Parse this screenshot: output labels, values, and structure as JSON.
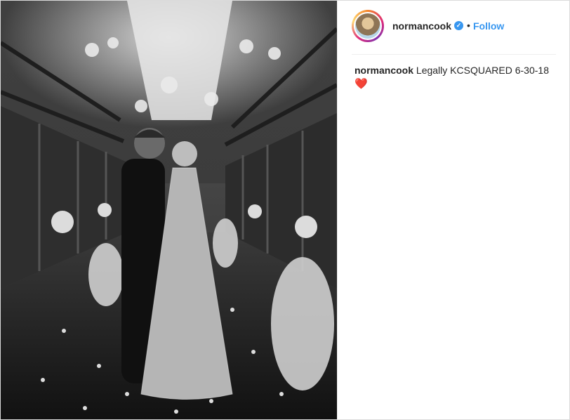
{
  "post": {
    "username": "normancook",
    "verified_icon": "verified-badge-icon",
    "separator": "•",
    "follow_label": "Follow",
    "caption_user": "normancook",
    "caption_text": "Legally KCSQUARED 6-30-18",
    "caption_emoji": "❤️",
    "accent_color": "#3897f0"
  },
  "photo": {
    "description_icon": "wedding-photo-image"
  }
}
